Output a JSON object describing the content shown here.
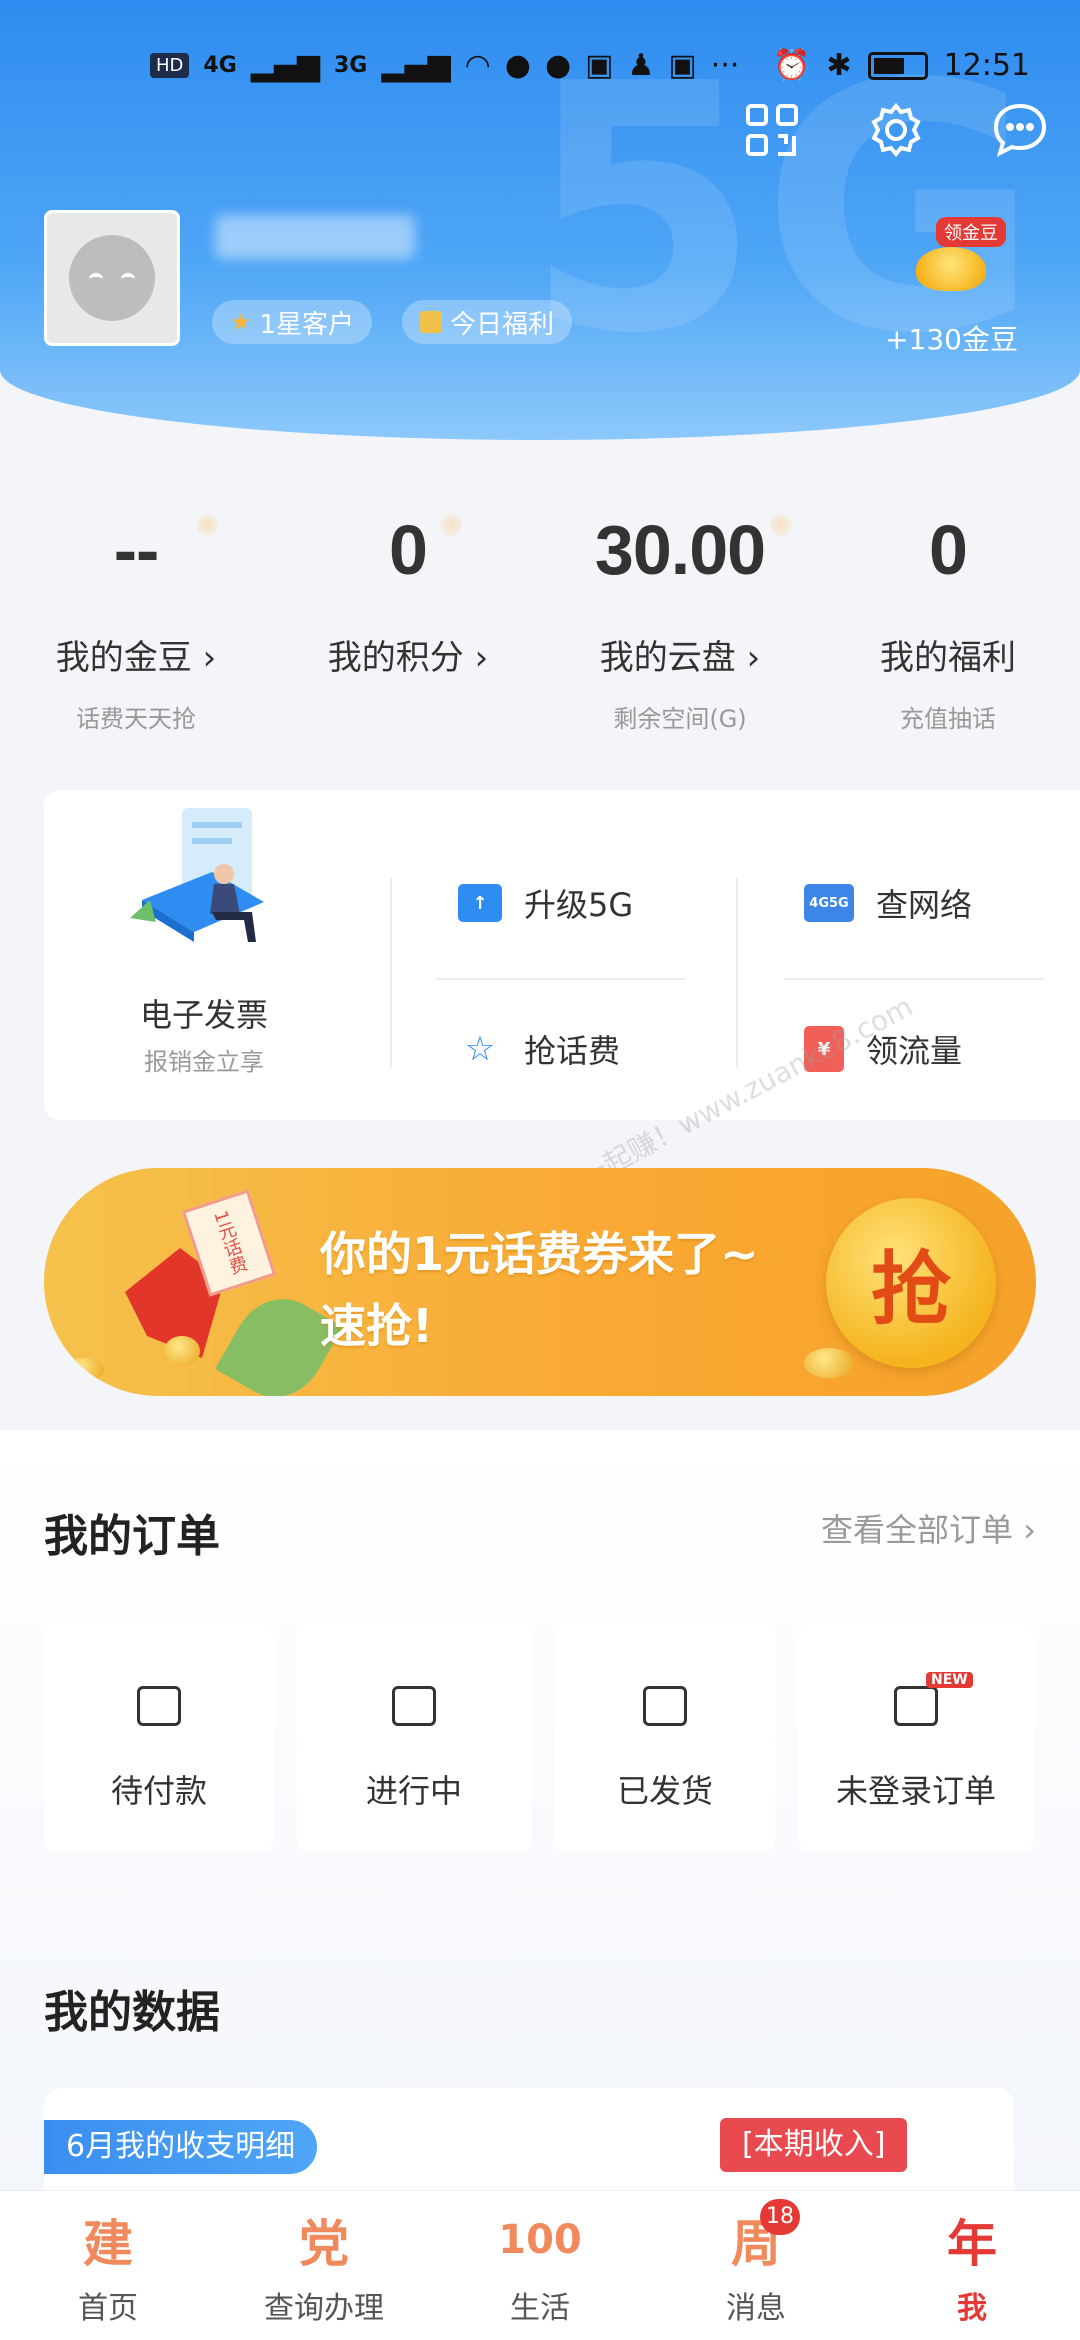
{
  "status_bar": {
    "net_badge": "HD",
    "sig1": "4G",
    "sig2": "3G",
    "more": "···",
    "time": "12:51"
  },
  "header": {
    "tags": [
      {
        "label": "1星客户"
      },
      {
        "label": "今日福利"
      }
    ],
    "gold_badge": "领金豆",
    "gold_text": "+130金豆",
    "deco": "5G"
  },
  "stats": [
    {
      "value": "--",
      "label": "我的金豆 ›",
      "sub": "话费天天抢"
    },
    {
      "value": "0",
      "label": "我的积分 ›",
      "sub": ""
    },
    {
      "value": "30.00",
      "label": "我的云盘 ›",
      "sub": "剩余空间(G)"
    },
    {
      "value": "0",
      "label": "我的福利",
      "sub": "充值抽话"
    }
  ],
  "services": {
    "invoice_title": "电子发票",
    "invoice_sub": "报销金立享",
    "items": [
      {
        "label": "升级5G",
        "icon": "upgrade-icon"
      },
      {
        "label": "查网络",
        "icon": "network-4g5g-icon",
        "icon_text": "4G5G"
      },
      {
        "label": "抢话费",
        "icon": "star-icon"
      },
      {
        "label": "领流量",
        "icon": "red-envelope-icon",
        "icon_text": "¥"
      }
    ]
  },
  "banner": {
    "line1": "你的1元话费券来了~",
    "line2": "速抢!",
    "button": "抢",
    "ticket": "1元话费"
  },
  "watermark": "赚客吧，有奖一起赚！www.zuanke8.com",
  "orders": {
    "title": "我的订单",
    "view_all": "查看全部订单 ›",
    "items": [
      {
        "label": "待付款"
      },
      {
        "label": "进行中"
      },
      {
        "label": "已发货"
      },
      {
        "label": "未登录订单",
        "badge": "NEW"
      }
    ]
  },
  "data_section": {
    "title": "我的数据",
    "pill": "6月我的收支明细",
    "tag": "[本期收入]"
  },
  "nav": [
    {
      "label": "首页",
      "glyph": "建",
      "icon": "home-icon"
    },
    {
      "label": "查询办理",
      "glyph": "党",
      "icon": "query-icon"
    },
    {
      "label": "生活",
      "glyph": "100",
      "icon": "life-icon"
    },
    {
      "label": "消息",
      "glyph": "周",
      "icon": "message-icon",
      "badge": "18"
    },
    {
      "label": "我",
      "glyph": "年",
      "icon": "me-icon",
      "active": true
    }
  ],
  "colors": {
    "brand_blue": "#2f8cf0",
    "accent_red": "#e53935",
    "banner_orange": "#f9a934"
  }
}
